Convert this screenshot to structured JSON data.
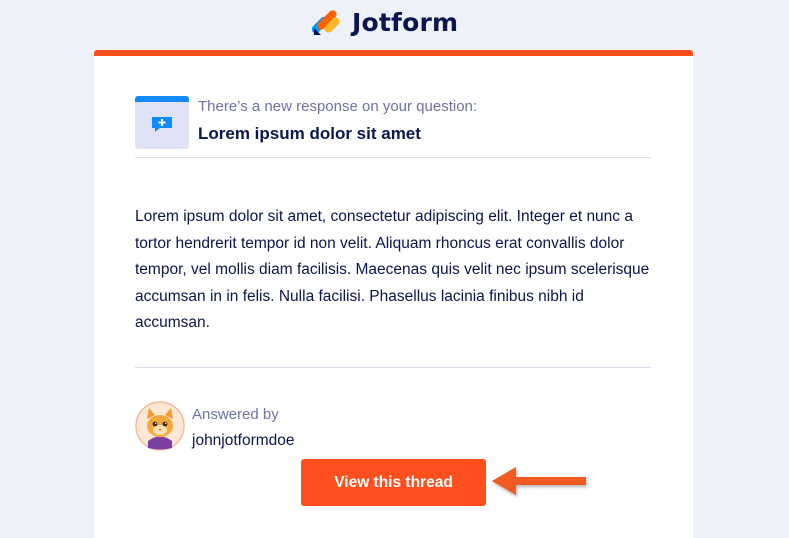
{
  "brand": {
    "name": "Jotform"
  },
  "question": {
    "subtitle": "There’s a new response on your question:",
    "title": "Lorem ipsum dolor sit amet"
  },
  "response": {
    "body": "Lorem ipsum dolor sit amet, consectetur adipiscing elit. Integer et nunc a tortor hendrerit tempor id non velit. Aliquam rhoncus erat convallis dolor tempor, vel mollis diam facilisis. Maecenas quis velit nec ipsum scelerisque accumsan in in felis. Nulla facilisi. Phasellus lacinia finibus nibh id accumsan."
  },
  "answer": {
    "label": "Answered by",
    "username": "johnjotformdoe"
  },
  "cta": {
    "label": "View this thread"
  },
  "icons": {
    "logo": "jotform-logo-icon",
    "question": "chat-plus-icon",
    "avatar": "cat-avatar-icon",
    "pointer": "arrow-left-icon"
  },
  "colors": {
    "accent": "#ff4f1f",
    "navy": "#0a1551",
    "muted": "#6c73a8",
    "blue": "#0f8bff",
    "background": "#eff1f9"
  }
}
